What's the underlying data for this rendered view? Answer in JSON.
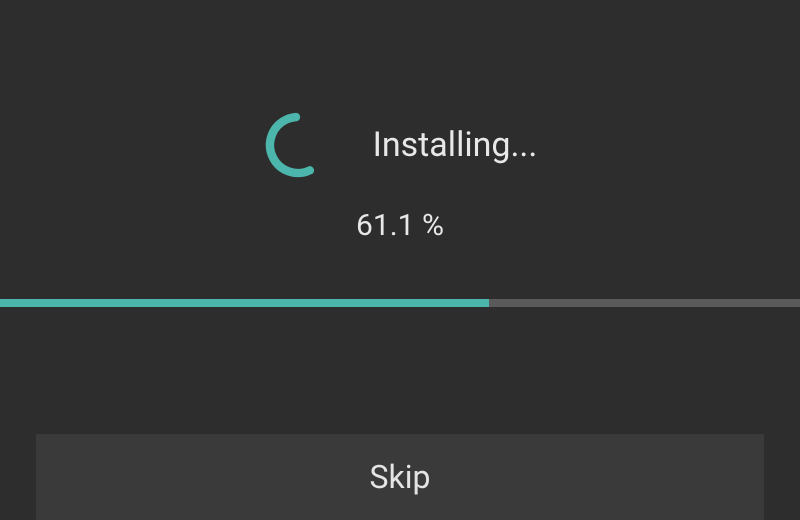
{
  "status": {
    "label": "Installing...",
    "percent_text": "61.1 %",
    "percent_value": 61.1
  },
  "colors": {
    "accent": "#4db6ac",
    "background": "#2d2d2d",
    "button_bg": "#3a3a3a",
    "track": "#5a5a5a"
  },
  "actions": {
    "skip_label": "Skip"
  }
}
